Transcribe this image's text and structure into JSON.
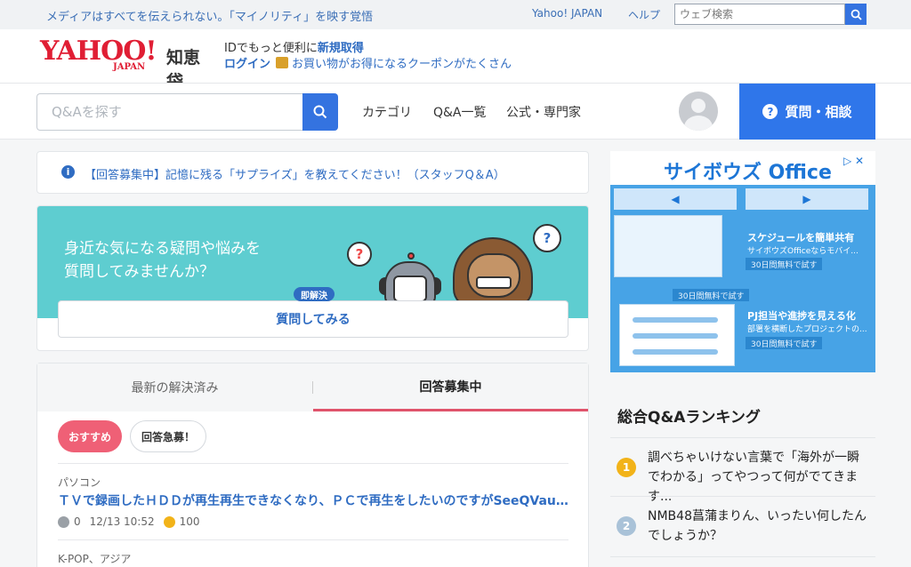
{
  "topbar": {
    "tagline": "メディアはすべてを伝えられない。「マイノリティ」を映す覚悟",
    "yahoo_japan_link": "Yahoo! JAPAN",
    "help_link": "ヘルプ",
    "web_search_placeholder": "ウェブ検索"
  },
  "header": {
    "logo_yahoo": "YAHOO!",
    "logo_japan": "JAPAN",
    "logo_service": "知恵袋",
    "id_prefix": "IDでもっと便利に",
    "id_register": "新規取得",
    "login": "ログイン",
    "coupon_text": "お買い物がお得になるクーポンがたくさん"
  },
  "nav": {
    "search_placeholder": "Q&Aを探す",
    "links": [
      "カテゴリ",
      "Q&A一覧",
      "公式・専門家"
    ],
    "ask_button": "質問・相談"
  },
  "notice": {
    "text": "【回答募集中】記憶に残る「サプライズ」を教えてください！（スタッフQ＆A）"
  },
  "promo": {
    "line1": "身近な気になる疑問や悩みを",
    "line2": "質問してみませんか？",
    "badge": "即解決",
    "cta": "質問してみる"
  },
  "tabs": {
    "items": [
      "最新の解決済み",
      "回答募集中"
    ],
    "active": 1
  },
  "filters": {
    "recommended": "おすすめ",
    "urgent": "回答急募！"
  },
  "questions": [
    {
      "category": "パソコン",
      "title": "ＴＶで録画したＨＤＤが再生再生できなくなり、ＰＣで再生をしたいのですがSeeQVault...",
      "answers": "0",
      "datetime": "12/13 10:52",
      "coins": "100"
    },
    {
      "category": "K-POP、アジア"
    }
  ],
  "ad": {
    "brand": "サイボウズ Office",
    "prev": "◀",
    "next": "▶",
    "feature1": "スケジュールを簡単共有",
    "feature1_sub": "サイボウズOfficeならモバイ...",
    "feature1_badge": "30日間無料で試す",
    "feature0_badge": "30日間無料で試す",
    "feature2": "PJ担当や進捗を見える化",
    "feature2_sub": "部署を横断したプロジェクトの...",
    "feature2_badge": "30日間無料で試す",
    "close": "▷ ✕"
  },
  "ranking": {
    "title": "総合Q&Aランキング",
    "items": [
      {
        "rank": "1",
        "text": "調べちゃいけない言葉で「海外が一瞬でわかる」ってやつって何がでてきます..."
      },
      {
        "rank": "2",
        "text": "NMB48菖蒲まりん、いったい何したんでしょうか？"
      }
    ]
  },
  "colors": {
    "accent": "#2f76ea",
    "link": "#2f6cc2",
    "brand_red": "#e01e34",
    "promo_teal": "#5ecdd0",
    "recommend_pink": "#ef6076",
    "rank1": "#f2b319",
    "rank2": "#a9c2d8"
  }
}
